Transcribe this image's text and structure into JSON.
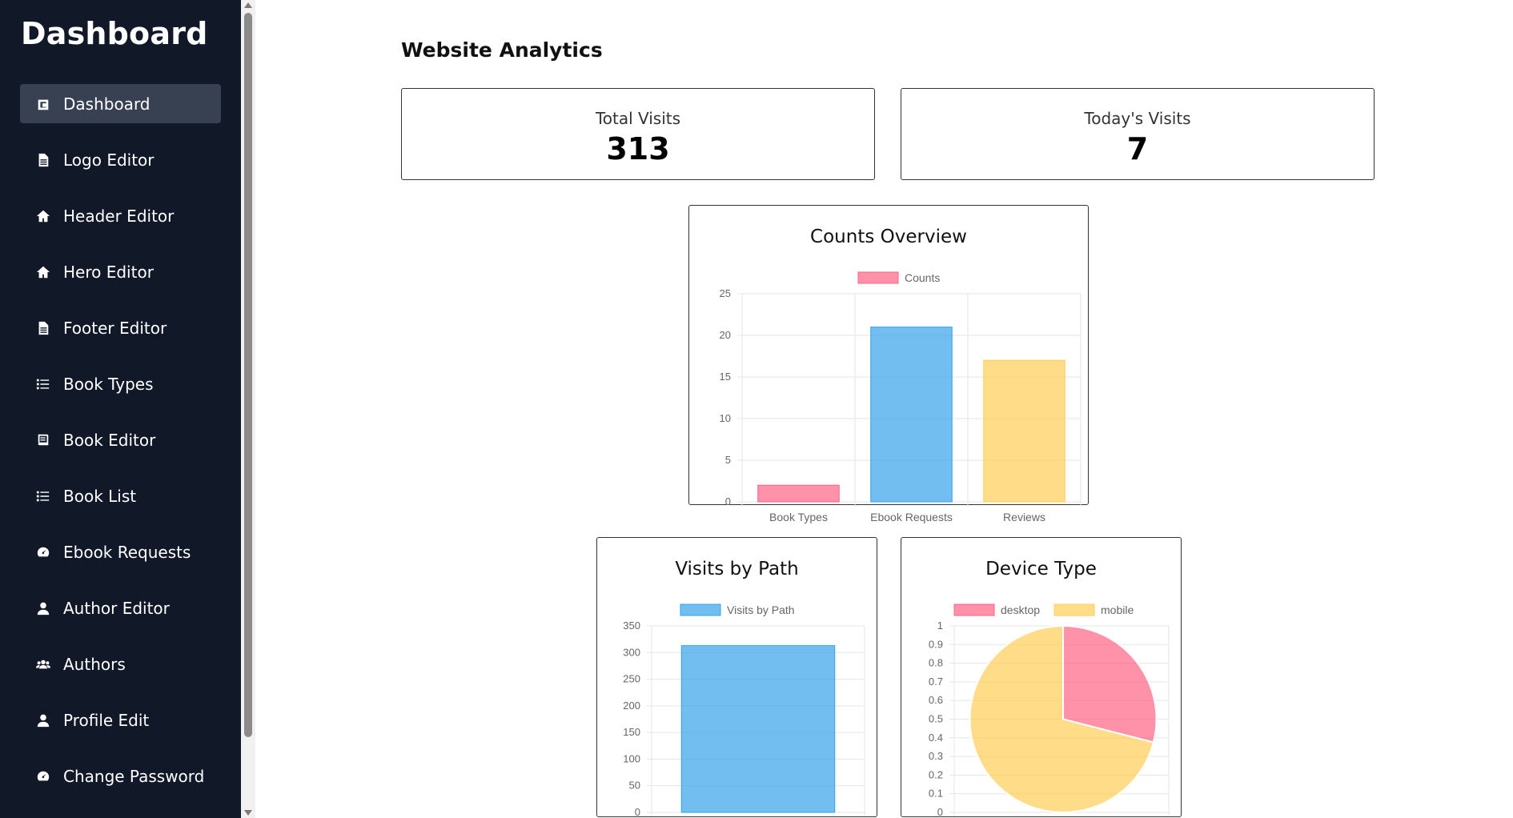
{
  "sidebar": {
    "brand": "Dashboard",
    "items": [
      {
        "label": "Dashboard",
        "icon": "dashboard-icon",
        "active": true
      },
      {
        "label": "Logo Editor",
        "icon": "file-icon"
      },
      {
        "label": "Header Editor",
        "icon": "home-icon"
      },
      {
        "label": "Hero Editor",
        "icon": "home-icon"
      },
      {
        "label": "Footer Editor",
        "icon": "file-icon"
      },
      {
        "label": "Book Types",
        "icon": "list-icon"
      },
      {
        "label": "Book Editor",
        "icon": "book-icon"
      },
      {
        "label": "Book List",
        "icon": "list-icon"
      },
      {
        "label": "Ebook Requests",
        "icon": "gauge-icon"
      },
      {
        "label": "Author Editor",
        "icon": "user-icon"
      },
      {
        "label": "Authors",
        "icon": "users-icon"
      },
      {
        "label": "Profile Edit",
        "icon": "user-icon"
      },
      {
        "label": "Change Password",
        "icon": "gauge-icon"
      }
    ]
  },
  "main": {
    "title": "Website Analytics",
    "stats": [
      {
        "label": "Total Visits",
        "value": "313"
      },
      {
        "label": "Today's Visits",
        "value": "7"
      }
    ]
  },
  "colors": {
    "sidebar_bg": "#111827",
    "active_item_bg": "#374151",
    "pink": "#FF6384",
    "blue": "#36A2EB",
    "yellow": "#FFCE56"
  },
  "chart_data": [
    {
      "type": "bar",
      "title": "Counts Overview",
      "categories": [
        "Book Types",
        "Ebook Requests",
        "Reviews"
      ],
      "series": [
        {
          "name": "Counts",
          "values": [
            2,
            21,
            17
          ]
        }
      ],
      "bar_colors": [
        "#FF6384",
        "#36A2EB",
        "#FFCE56"
      ],
      "ylim": [
        0,
        25
      ],
      "yticks": [
        "25",
        "20",
        "15",
        "10",
        "5",
        "0"
      ],
      "grid": true,
      "legend": "top-center"
    },
    {
      "type": "bar",
      "title": "Visits by Path",
      "categories": [
        ""
      ],
      "series": [
        {
          "name": "Visits by Path",
          "values": [
            313
          ]
        }
      ],
      "ylim": [
        0,
        350
      ],
      "yticks": [
        "350",
        "300",
        "250",
        "200",
        "150",
        "100",
        "50",
        "0"
      ],
      "grid": true,
      "legend": "top-center"
    },
    {
      "type": "pie",
      "title": "Device Type",
      "labels": [
        "desktop",
        "mobile"
      ],
      "values": [
        0.29,
        0.71
      ],
      "yticks": [
        "1",
        "0.9",
        "0.8",
        "0.7",
        "0.6",
        "0.5",
        "0.4",
        "0.3",
        "0.2",
        "0.1",
        "0"
      ],
      "grid": true,
      "legend": "top-center"
    }
  ]
}
